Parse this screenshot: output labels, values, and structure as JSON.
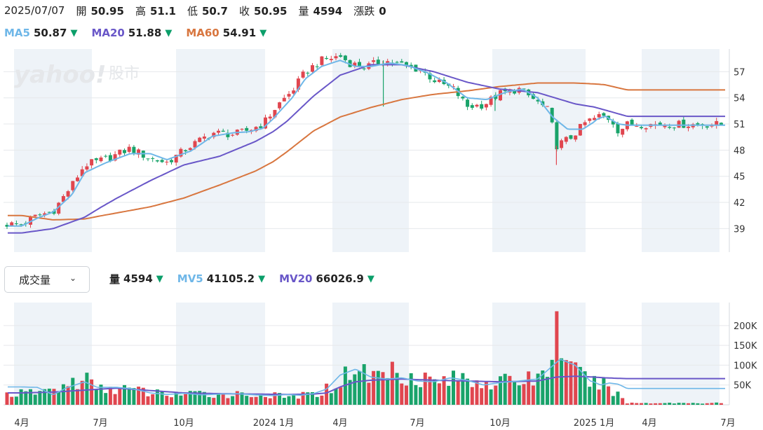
{
  "header": {
    "date": "2025/07/07",
    "open_label": "開",
    "open": "50.95",
    "high_label": "高",
    "high": "51.1",
    "low_label": "低",
    "low": "50.7",
    "close_label": "收",
    "close": "50.95",
    "volume_label": "量",
    "volume": "4594",
    "change_label": "漲跌",
    "change": "0"
  },
  "ma_legend": [
    {
      "label": "MA5",
      "value": "50.87",
      "color": "#6fb7e8",
      "trend": "down"
    },
    {
      "label": "MA20",
      "value": "51.88",
      "color": "#6957c8",
      "trend": "down"
    },
    {
      "label": "MA60",
      "value": "54.91",
      "color": "#d8763f",
      "trend": "down"
    }
  ],
  "volume_select": {
    "label": "成交量",
    "icon": "chevron-down-icon"
  },
  "volume_legend": {
    "vol_label": "量",
    "vol_value": "4594",
    "mv5_label": "MV5",
    "mv5_value": "41105.2",
    "mv20_label": "MV20",
    "mv20_value": "66026.9"
  },
  "watermark": {
    "brand": "yahoo!",
    "sub": "股市"
  },
  "colors": {
    "up": "#e0464f",
    "down": "#19a36a",
    "ma5": "#6fb7e8",
    "ma20": "#6957c8",
    "ma60": "#d8763f",
    "band": "#eef3f8",
    "arrow": "#0c9f6a"
  },
  "chart_data": [
    {
      "type": "candlestick",
      "title": "",
      "x_ticks": [
        "4月",
        "7月",
        "10月",
        "2024 1月",
        "4月",
        "7月",
        "10月",
        "2025 1月",
        "4月",
        "7月"
      ],
      "y_ticks": [
        39,
        42,
        45,
        48,
        51,
        54,
        57
      ],
      "ylim": [
        36.3,
        59.6
      ],
      "grid": true,
      "price_points": [
        {
          "t": 0,
          "c": 39.5
        },
        {
          "t": 0.05,
          "c": 40.5
        },
        {
          "t": 0.1,
          "c": 41.0
        },
        {
          "t": 0.16,
          "c": 44.0
        },
        {
          "t": 0.2,
          "c": 46.3
        },
        {
          "t": 0.27,
          "c": 47.0
        },
        {
          "t": 0.34,
          "c": 48.2
        },
        {
          "t": 0.4,
          "c": 47.0
        },
        {
          "t": 0.45,
          "c": 46.6
        },
        {
          "t": 0.52,
          "c": 48.5
        },
        {
          "t": 0.58,
          "c": 50.0
        },
        {
          "t": 0.64,
          "c": 49.8
        },
        {
          "t": 0.68,
          "c": 50.3
        },
        {
          "t": 0.72,
          "c": 51.0
        },
        {
          "t": 0.76,
          "c": 53.0
        },
        {
          "t": 0.82,
          "c": 54.8
        },
        {
          "t": 0.87,
          "c": 57.0
        },
        {
          "t": 0.93,
          "c": 58.3
        },
        {
          "t": 1.0,
          "c": 58.8
        },
        {
          "t": 1.03,
          "c": 58.0
        },
        {
          "t": 1.08,
          "c": 57.5
        },
        {
          "t": 1.14,
          "c": 58.3
        },
        {
          "t": 1.2,
          "c": 57.8
        },
        {
          "t": 1.26,
          "c": 57.2
        },
        {
          "t": 1.31,
          "c": 55.8
        },
        {
          "t": 1.36,
          "c": 55.0
        },
        {
          "t": 1.4,
          "c": 53.0
        },
        {
          "t": 1.45,
          "c": 53.2
        },
        {
          "t": 1.5,
          "c": 54.5
        },
        {
          "t": 1.55,
          "c": 55.0
        },
        {
          "t": 1.6,
          "c": 53.5
        },
        {
          "t": 1.63,
          "c": 52.5
        },
        {
          "t": 1.65,
          "c": 48.5
        },
        {
          "t": 1.69,
          "c": 49.5
        },
        {
          "t": 1.73,
          "c": 51.3
        },
        {
          "t": 1.78,
          "c": 52.0
        },
        {
          "t": 1.83,
          "c": 51.5
        },
        {
          "t": 1.86,
          "c": 50.2
        },
        {
          "t": 1.9,
          "c": 50.95
        }
      ],
      "spikes": [
        {
          "t": 1.14,
          "low": 53.0
        },
        {
          "t": 1.65,
          "low": 46.3
        },
        {
          "t": 1.485,
          "low": 52.5
        }
      ],
      "series": [
        {
          "name": "MA5",
          "points": [
            [
              0,
              39.3
            ],
            [
              0.05,
              40.2
            ],
            [
              0.1,
              40.9
            ],
            [
              0.16,
              42.9
            ],
            [
              0.2,
              45.4
            ],
            [
              0.27,
              46.6
            ],
            [
              0.34,
              47.6
            ],
            [
              0.4,
              47.6
            ],
            [
              0.45,
              46.9
            ],
            [
              0.52,
              47.9
            ],
            [
              0.58,
              49.6
            ],
            [
              0.64,
              50.0
            ],
            [
              0.68,
              50.1
            ],
            [
              0.72,
              50.5
            ],
            [
              0.76,
              52.0
            ],
            [
              0.82,
              54.0
            ],
            [
              0.87,
              56.2
            ],
            [
              0.93,
              57.6
            ],
            [
              1.0,
              58.3
            ],
            [
              1.05,
              57.6
            ],
            [
              1.1,
              57.6
            ],
            [
              1.16,
              58.0
            ],
            [
              1.22,
              57.7
            ],
            [
              1.28,
              56.9
            ],
            [
              1.34,
              55.7
            ],
            [
              1.4,
              54.0
            ],
            [
              1.46,
              53.8
            ],
            [
              1.52,
              54.7
            ],
            [
              1.56,
              55.0
            ],
            [
              1.6,
              54.0
            ],
            [
              1.64,
              51.8
            ],
            [
              1.68,
              50.4
            ],
            [
              1.72,
              50.4
            ],
            [
              1.76,
              51.5
            ],
            [
              1.8,
              51.9
            ],
            [
              1.86,
              51.0
            ],
            [
              1.9,
              50.87
            ]
          ]
        },
        {
          "name": "MA20",
          "points": [
            [
              0,
              38.5
            ],
            [
              0.1,
              39.0
            ],
            [
              0.2,
              40.3
            ],
            [
              0.3,
              42.5
            ],
            [
              0.4,
              44.5
            ],
            [
              0.5,
              46.3
            ],
            [
              0.6,
              47.3
            ],
            [
              0.7,
              49.0
            ],
            [
              0.8,
              51.3
            ],
            [
              0.9,
              54.2
            ],
            [
              1.0,
              56.6
            ],
            [
              1.1,
              57.8
            ],
            [
              1.2,
              57.8
            ],
            [
              1.3,
              57.0
            ],
            [
              1.4,
              55.8
            ],
            [
              1.5,
              55.0
            ],
            [
              1.6,
              54.6
            ],
            [
              1.7,
              53.3
            ],
            [
              1.8,
              52.6
            ],
            [
              1.9,
              51.88
            ]
          ]
        },
        {
          "name": "MA60",
          "points": [
            [
              0,
              40.5
            ],
            [
              0.1,
              40.0
            ],
            [
              0.2,
              40.1
            ],
            [
              0.3,
              40.8
            ],
            [
              0.4,
              41.5
            ],
            [
              0.5,
              42.5
            ],
            [
              0.6,
              44.0
            ],
            [
              0.7,
              45.6
            ],
            [
              0.8,
              47.8
            ],
            [
              0.9,
              50.2
            ],
            [
              1.0,
              51.8
            ],
            [
              1.1,
              52.9
            ],
            [
              1.2,
              53.8
            ],
            [
              1.3,
              54.4
            ],
            [
              1.4,
              54.8
            ],
            [
              1.5,
              55.3
            ],
            [
              1.6,
              55.7
            ],
            [
              1.7,
              55.7
            ],
            [
              1.8,
              55.5
            ],
            [
              1.9,
              54.91
            ]
          ]
        }
      ]
    },
    {
      "type": "bar",
      "title": "成交量",
      "y_ticks": [
        "50K",
        "100K",
        "150K",
        "200K"
      ],
      "ylim": [
        0,
        258000
      ],
      "grid": true,
      "volume_points": [
        {
          "t": 0,
          "v": 28000
        },
        {
          "t": 0.1,
          "v": 38000
        },
        {
          "t": 0.2,
          "v": 65000
        },
        {
          "t": 0.25,
          "v": 38000
        },
        {
          "t": 0.3,
          "v": 44000
        },
        {
          "t": 0.4,
          "v": 30000
        },
        {
          "t": 0.5,
          "v": 26000
        },
        {
          "t": 0.6,
          "v": 28000
        },
        {
          "t": 0.7,
          "v": 26000
        },
        {
          "t": 0.8,
          "v": 20000
        },
        {
          "t": 0.9,
          "v": 26000
        },
        {
          "t": 1.0,
          "v": 55000
        },
        {
          "t": 1.04,
          "v": 100000
        },
        {
          "t": 1.1,
          "v": 70000
        },
        {
          "t": 1.16,
          "v": 90000
        },
        {
          "t": 1.22,
          "v": 78000
        },
        {
          "t": 1.3,
          "v": 60000
        },
        {
          "t": 1.4,
          "v": 68000
        },
        {
          "t": 1.5,
          "v": 55000
        },
        {
          "t": 1.6,
          "v": 70000
        },
        {
          "t": 1.63,
          "v": 90000
        },
        {
          "t": 1.65,
          "v": 236000
        },
        {
          "t": 1.68,
          "v": 90000
        },
        {
          "t": 1.75,
          "v": 55000
        },
        {
          "t": 1.82,
          "v": 45000
        },
        {
          "t": 1.9,
          "v": 4594
        }
      ],
      "series": [
        {
          "name": "MV5",
          "points": [
            [
              0,
              45000
            ],
            [
              0.05,
              44000
            ],
            [
              0.1,
              25000
            ],
            [
              0.14,
              42000
            ],
            [
              0.2,
              58000
            ],
            [
              0.24,
              44000
            ],
            [
              0.3,
              44000
            ],
            [
              0.35,
              40000
            ],
            [
              0.4,
              30000
            ],
            [
              0.45,
              26000
            ],
            [
              0.5,
              29000
            ],
            [
              0.55,
              25000
            ],
            [
              0.6,
              27000
            ],
            [
              0.65,
              28000
            ],
            [
              0.7,
              25000
            ],
            [
              0.75,
              23000
            ],
            [
              0.8,
              26000
            ],
            [
              0.85,
              24000
            ],
            [
              0.9,
              28000
            ],
            [
              0.95,
              40000
            ],
            [
              1.0,
              75000
            ],
            [
              1.05,
              90000
            ],
            [
              1.1,
              70000
            ],
            [
              1.15,
              65000
            ],
            [
              1.2,
              68000
            ],
            [
              1.25,
              60000
            ],
            [
              1.3,
              58000
            ],
            [
              1.35,
              68000
            ],
            [
              1.4,
              62000
            ],
            [
              1.45,
              50000
            ],
            [
              1.5,
              56000
            ],
            [
              1.55,
              60000
            ],
            [
              1.6,
              65000
            ],
            [
              1.63,
              90000
            ],
            [
              1.66,
              115000
            ],
            [
              1.7,
              100000
            ],
            [
              1.74,
              60000
            ],
            [
              1.78,
              50000
            ],
            [
              1.82,
              55000
            ],
            [
              1.86,
              52000
            ],
            [
              1.9,
              41105
            ]
          ]
        },
        {
          "name": "MV20",
          "points": [
            [
              0,
              30000
            ],
            [
              0.1,
              32000
            ],
            [
              0.2,
              37000
            ],
            [
              0.3,
              42000
            ],
            [
              0.4,
              36000
            ],
            [
              0.5,
              30000
            ],
            [
              0.6,
              28000
            ],
            [
              0.7,
              27000
            ],
            [
              0.8,
              26000
            ],
            [
              0.9,
              27000
            ],
            [
              0.95,
              30000
            ],
            [
              1.0,
              45000
            ],
            [
              1.05,
              58000
            ],
            [
              1.1,
              62000
            ],
            [
              1.2,
              65000
            ],
            [
              1.3,
              62000
            ],
            [
              1.4,
              60000
            ],
            [
              1.5,
              58000
            ],
            [
              1.6,
              60000
            ],
            [
              1.65,
              70000
            ],
            [
              1.7,
              72000
            ],
            [
              1.8,
              68000
            ],
            [
              1.9,
              66027
            ]
          ]
        }
      ]
    }
  ]
}
